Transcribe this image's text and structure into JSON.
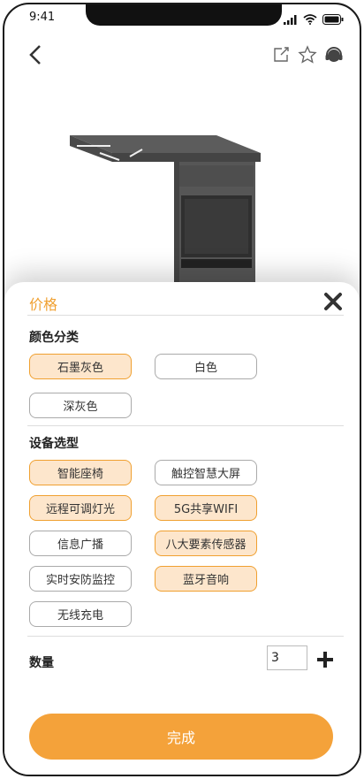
{
  "status": {
    "time": "9:41"
  },
  "nav": {
    "back_icon": "chevron-left-icon",
    "actions": [
      "share-icon",
      "star-icon",
      "headset-icon"
    ]
  },
  "sheet": {
    "title": "价格",
    "color_section": {
      "title": "颜色分类",
      "options": [
        {
          "label": "石墨灰色",
          "selected": true
        },
        {
          "label": "白色",
          "selected": false
        },
        {
          "label": "深灰色",
          "selected": false
        }
      ]
    },
    "device_section": {
      "title": "设备选型",
      "options": [
        {
          "label": "智能座椅",
          "selected": true
        },
        {
          "label": "触控智慧大屏",
          "selected": false
        },
        {
          "label": "远程可调灯光",
          "selected": true
        },
        {
          "label": "5G共享WIFI",
          "selected": true
        },
        {
          "label": "信息广播",
          "selected": false
        },
        {
          "label": "八大要素传感器",
          "selected": true
        },
        {
          "label": "实时安防监控",
          "selected": false
        },
        {
          "label": "蓝牙音响",
          "selected": true
        },
        {
          "label": "无线充电",
          "selected": false
        }
      ]
    },
    "quantity": {
      "label": "数量",
      "value": "3"
    },
    "done_label": "完成"
  },
  "colors": {
    "accent": "#f4a23a",
    "chip_selected_bg": "#fde6cc",
    "chip_selected_border": "#f0a030"
  }
}
